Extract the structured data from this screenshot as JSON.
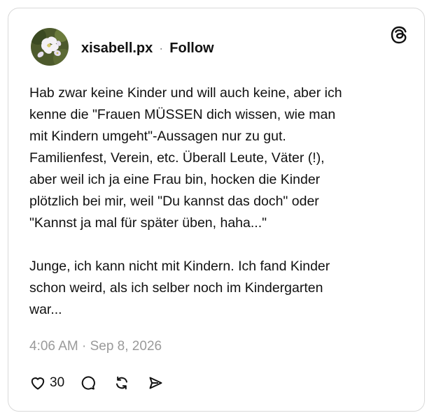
{
  "post": {
    "author": {
      "username": "xisabell.px",
      "separator": "·",
      "follow_label": "Follow",
      "avatar": "avatar-flower-photo"
    },
    "brand_icon": "threads-logo-icon",
    "text_paragraphs": [
      "Hab zwar keine Kinder und will auch keine, aber ich\nkenne die \"Frauen MÜSSEN dich wissen, wie man\nmit Kindern umgeht\"-Aussagen nur zu gut.\nFamilienfest, Verein, etc. Überall Leute, Väter (!),\naber weil ich ja eine Frau bin, hocken die Kinder\nplötzlich bei mir, weil \"Du kannst das doch\" oder\n\"Kannst ja mal für später üben, haha...\"",
      "Junge, ich kann nicht mit Kindern. Ich fand Kinder\nschon weird, als ich selber noch im Kindergarten\nwar..."
    ],
    "timestamp": "4:06 AM · Sep 8, 2026",
    "actions": {
      "like_icon": "heart-icon",
      "like_count": "30",
      "comment_icon": "comment-icon",
      "repost_icon": "repost-icon",
      "share_icon": "share-icon"
    }
  },
  "colors": {
    "text": "#111111",
    "muted": "#9a9a9a",
    "border": "#d9d9d9",
    "background": "#ffffff"
  }
}
